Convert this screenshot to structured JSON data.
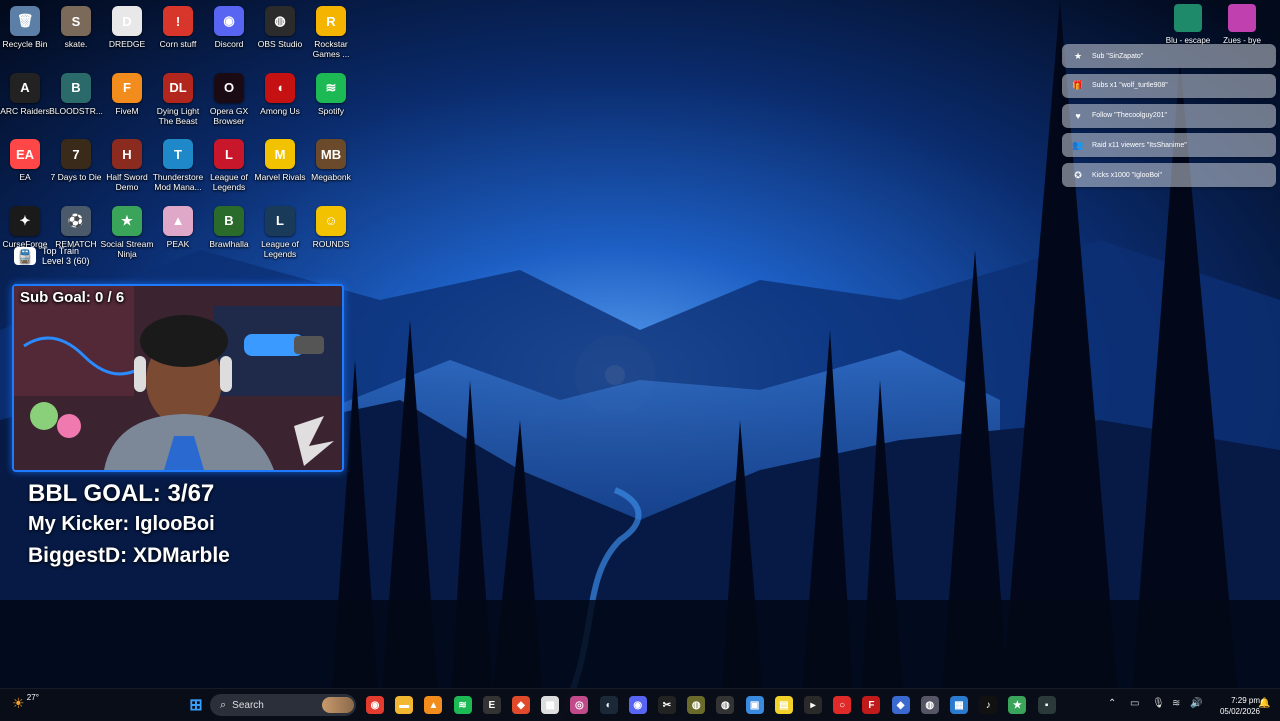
{
  "desktop_icons": [
    {
      "label": "Recycle Bin",
      "color": "#5b7fa6",
      "glyph": "🗑"
    },
    {
      "label": "skate.",
      "color": "#7b6a5a",
      "glyph": "S"
    },
    {
      "label": "DREDGE",
      "color": "#e8e8e8",
      "glyph": "D"
    },
    {
      "label": "Corn stuff",
      "color": "#d8362a",
      "glyph": "!"
    },
    {
      "label": "Discord",
      "color": "#5865f2",
      "glyph": "◉"
    },
    {
      "label": "OBS Studio",
      "color": "#2b2b2b",
      "glyph": "◍"
    },
    {
      "label": "Rockstar Games ...",
      "color": "#f5b400",
      "glyph": "R"
    },
    {
      "label": "ARC Raiders",
      "color": "#222222",
      "glyph": "A"
    },
    {
      "label": "BLOODSTR...",
      "color": "#2a6a6a",
      "glyph": "B"
    },
    {
      "label": "FiveM",
      "color": "#f28c1c",
      "glyph": "F"
    },
    {
      "label": "Dying Light The Beast",
      "color": "#b3261e",
      "glyph": "DL"
    },
    {
      "label": "Opera GX Browser",
      "color": "#1a0a14",
      "glyph": "O"
    },
    {
      "label": "Among Us",
      "color": "#c51111",
      "glyph": "◖"
    },
    {
      "label": "Spotify",
      "color": "#1db954",
      "glyph": "≋"
    },
    {
      "label": "EA",
      "color": "#ff4747",
      "glyph": "EA"
    },
    {
      "label": "7 Days to Die",
      "color": "#3a2a1a",
      "glyph": "7"
    },
    {
      "label": "Half Sword Demo",
      "color": "#8b2b1f",
      "glyph": "H"
    },
    {
      "label": "Thunderstore Mod Mana...",
      "color": "#1e88c8",
      "glyph": "T"
    },
    {
      "label": "League of Legends",
      "color": "#c8162a",
      "glyph": "L"
    },
    {
      "label": "Marvel Rivals",
      "color": "#f2c200",
      "glyph": "M"
    },
    {
      "label": "Megabonk",
      "color": "#6a4a2a",
      "glyph": "MB"
    },
    {
      "label": "CurseForge",
      "color": "#1a1a1a",
      "glyph": "✦"
    },
    {
      "label": "REMATCH",
      "color": "#4a5a6a",
      "glyph": "⚽"
    },
    {
      "label": "Social Stream Ninja",
      "color": "#3aa55a",
      "glyph": "★"
    },
    {
      "label": "PEAK",
      "color": "#e0a8c8",
      "glyph": "▲"
    },
    {
      "label": "Brawlhalla",
      "color": "#2a6a2a",
      "glyph": "B"
    },
    {
      "label": "League of Legends",
      "color": "#1a3a5a",
      "glyph": "L"
    },
    {
      "label": "ROUNDS",
      "color": "#f2c200",
      "glyph": "☺"
    }
  ],
  "top_train": {
    "line1": "Top Train",
    "line2": "Level 3  (60)"
  },
  "overlay": {
    "sub_goal": "Sub Goal:  0 / 6",
    "bbl_goal": "BBL GOAL: 3/67",
    "kicker": "My Kicker: IglooBoi",
    "biggest": "BiggestD: XDMarble"
  },
  "top_right_icons": [
    {
      "label": "Blu - escape",
      "color": "#1f8a6a"
    },
    {
      "label": "Zues - bye",
      "color": "#c040b0"
    }
  ],
  "notifications": [
    {
      "icon": "★",
      "text": "Sub \"SinZapato\""
    },
    {
      "icon": "🎁",
      "text": "Subs x1 \"wolf_turtle908\""
    },
    {
      "icon": "♥",
      "text": "Follow \"Thecoolguy201\""
    },
    {
      "icon": "👥",
      "text": "Raid x11 viewers \"ItsShanime\""
    },
    {
      "icon": "✪",
      "text": "Kicks x1000 \"IglooBoi\""
    }
  ],
  "taskbar": {
    "weather_temp": "27°",
    "search_label": "Search",
    "clock_time": "7:29 pm",
    "clock_date": "05/02/2026"
  },
  "taskbar_apps": [
    {
      "name": "chrome",
      "color": "#e33b2e",
      "glyph": "◉"
    },
    {
      "name": "file-explorer",
      "color": "#f2b731",
      "glyph": "▬"
    },
    {
      "name": "vlc",
      "color": "#f28c1c",
      "glyph": "▲"
    },
    {
      "name": "spotify",
      "color": "#1db954",
      "glyph": "≋"
    },
    {
      "name": "epic-games",
      "color": "#333333",
      "glyph": "E"
    },
    {
      "name": "app-red",
      "color": "#e04a2a",
      "glyph": "◆"
    },
    {
      "name": "app-white",
      "color": "#dddddd",
      "glyph": "▦"
    },
    {
      "name": "app-pink",
      "color": "#c04a8a",
      "glyph": "◎"
    },
    {
      "name": "steam",
      "color": "#1b2838",
      "glyph": "◐"
    },
    {
      "name": "discord",
      "color": "#5865f2",
      "glyph": "◉"
    },
    {
      "name": "capcut",
      "color": "#222222",
      "glyph": "✂"
    },
    {
      "name": "app-olive",
      "color": "#6a6a2a",
      "glyph": "◍"
    },
    {
      "name": "obs",
      "color": "#333333",
      "glyph": "◍"
    },
    {
      "name": "photos",
      "color": "#3a8ae0",
      "glyph": "▣"
    },
    {
      "name": "sticky-notes",
      "color": "#f2d22a",
      "glyph": "▤"
    },
    {
      "name": "terminal",
      "color": "#2a2a2a",
      "glyph": "▸"
    },
    {
      "name": "app-red-ring",
      "color": "#e02a2a",
      "glyph": "○"
    },
    {
      "name": "fortnite",
      "color": "#c01a1a",
      "glyph": "F"
    },
    {
      "name": "app-diamond",
      "color": "#3a6ad0",
      "glyph": "◆"
    },
    {
      "name": "app-gray",
      "color": "#555566",
      "glyph": "◍"
    },
    {
      "name": "edge-like",
      "color": "#2a7ad0",
      "glyph": "▦"
    },
    {
      "name": "tiktok",
      "color": "#111111",
      "glyph": "♪"
    },
    {
      "name": "social-stream",
      "color": "#3aa55a",
      "glyph": "★"
    },
    {
      "name": "app-dark",
      "color": "#2a3a3a",
      "glyph": "▪"
    }
  ]
}
